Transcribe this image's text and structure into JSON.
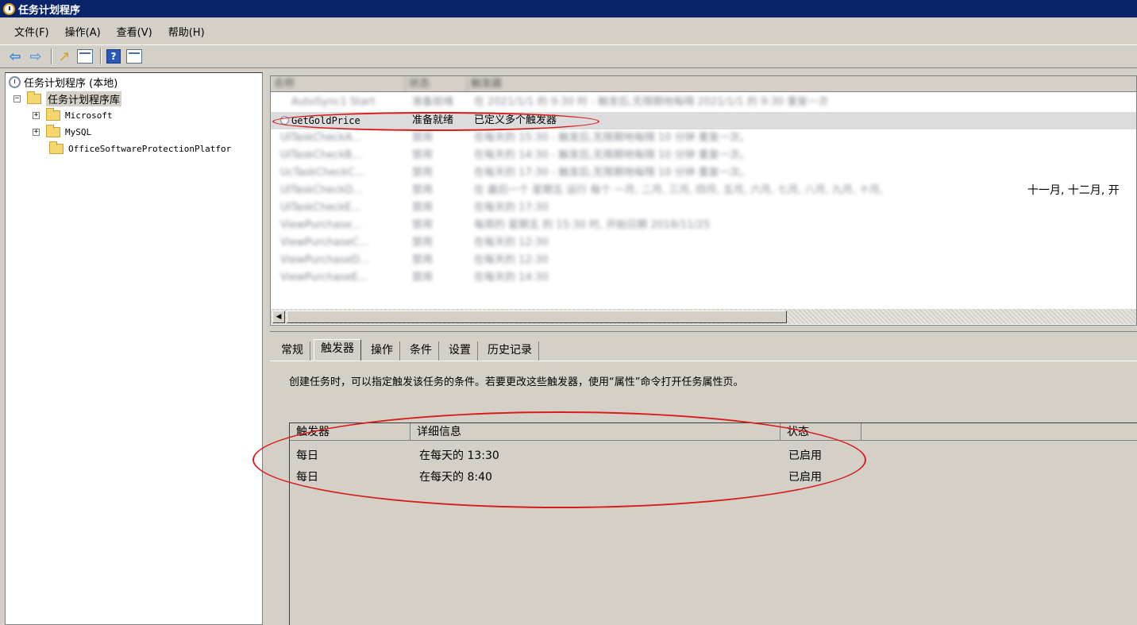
{
  "window": {
    "title": "任务计划程序"
  },
  "menu": [
    "文件(F)",
    "操作(A)",
    "查看(V)",
    "帮助(H)"
  ],
  "tree": {
    "root": "任务计划程序 (本地)",
    "library": "任务计划程序库",
    "children": [
      "Microsoft",
      "MySQL",
      "OfficeSoftwareProtectionPlatfor"
    ]
  },
  "task_list": {
    "columns": [
      "名称",
      "状态",
      "触发器"
    ],
    "rows": [
      {
        "name": "AutoSync1 Start",
        "status": "准备就绪",
        "trigger": "在 2021/1/1 的 9:30 时 - 触发后,无限期地每隔 2021/1/1 的 9:30 重复一次",
        "blurred": true
      },
      {
        "name": "GetGoldPrice",
        "status": "准备就绪",
        "trigger": "已定义多个触发器",
        "blurred": false
      },
      {
        "name": "UITaskCheckA...",
        "status": "禁用",
        "trigger": "在每天的 15:30 - 触发后,无限期地每隔 10 分钟 重复一次。",
        "blurred": true
      },
      {
        "name": "UITaskCheckB...",
        "status": "禁用",
        "trigger": "在每天的 14:30 - 触发后,无限期地每隔 10 分钟 重复一次。",
        "blurred": true
      },
      {
        "name": "UcTaskCheckC...",
        "status": "禁用",
        "trigger": "在每天的 17:30 - 触发后,无限期地每隔 10 分钟 重复一次。",
        "blurred": true
      },
      {
        "name": "UITaskCheckD...",
        "status": "禁用",
        "trigger": "在 最后一个 星期五 运行 每个 一月, 二月, 三月, 四月, 五月, 六月, 七月, 八月, 九月, 十月,",
        "tail": "十一月, 十二月, 开",
        "blurred": true
      },
      {
        "name": "UITaskCheckE...",
        "status": "禁用",
        "trigger": "在每天的 17:30",
        "blurred": true
      },
      {
        "name": "ViewPurchase...",
        "status": "禁用",
        "trigger": "每周的 星期五 的 15:30 时, 开始日期 2018/11/25",
        "blurred": true
      },
      {
        "name": "ViewPurchaseC...",
        "status": "禁用",
        "trigger": "在每天的 12:30",
        "blurred": true
      },
      {
        "name": "ViewPurchaseD...",
        "status": "禁用",
        "trigger": "在每天的 12:30",
        "blurred": true
      },
      {
        "name": "ViewPurchaseE...",
        "status": "禁用",
        "trigger": "在每天的 14:30",
        "blurred": true
      }
    ]
  },
  "detail": {
    "tabs": [
      "常规",
      "触发器",
      "操作",
      "条件",
      "设置",
      "历史记录"
    ],
    "active_tab": 1,
    "description": "创建任务时，可以指定触发该任务的条件。若要更改这些触发器，使用“属性”命令打开任务属性页。",
    "trigger_columns": [
      "触发器",
      "详细信息",
      "状态"
    ],
    "triggers": [
      {
        "type": "每日",
        "detail": "在每天的 13:30",
        "status": "已启用"
      },
      {
        "type": "每日",
        "detail": "在每天的 8:40",
        "status": "已启用"
      }
    ]
  },
  "colors": {
    "titlebar": "#0a246a",
    "annotation": "#d81c1c",
    "chrome": "#d4d0c8"
  }
}
